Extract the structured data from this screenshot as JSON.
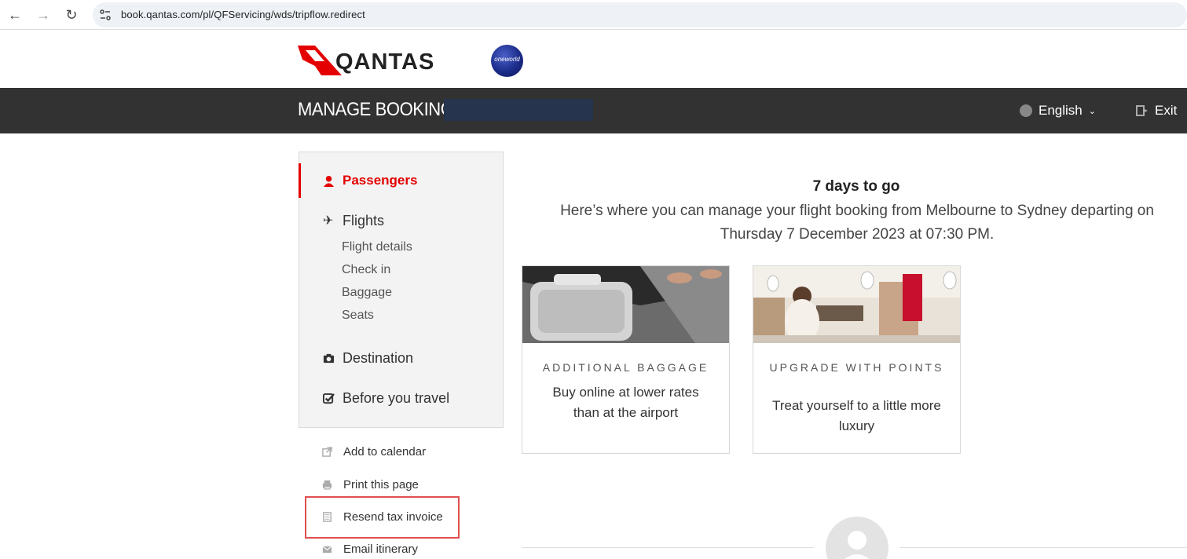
{
  "browser": {
    "url": "book.qantas.com/pl/QFServicing/wds/tripflow.redirect"
  },
  "brand": {
    "logo_text": "QANTAS",
    "alliance_text": "oneworld",
    "accent_color": "#e40000"
  },
  "header": {
    "title": "MANAGE BOOKING",
    "language": "English",
    "exit_label": "Exit"
  },
  "sidebar": {
    "passengers": "Passengers",
    "flights": "Flights",
    "flight_subitems": [
      "Flight details",
      "Check in",
      "Baggage",
      "Seats"
    ],
    "destination": "Destination",
    "before_you_travel": "Before you travel"
  },
  "actions": {
    "add_to_calendar": "Add to calendar",
    "print_page": "Print this page",
    "resend_tax_invoice": "Resend tax invoice",
    "email_itinerary": "Email itinerary"
  },
  "main": {
    "countdown": "7 days to go",
    "description": "Here’s where you can manage your flight booking from Melbourne to Sydney departing on Thursday 7 December 2023 at 07:30 PM.",
    "cards": [
      {
        "category": "ADDITIONAL BAGGAGE",
        "text": "Buy online at lower rates than at the airport"
      },
      {
        "category": "UPGRADE WITH POINTS",
        "text": "Treat yourself to a little more luxury"
      }
    ]
  }
}
